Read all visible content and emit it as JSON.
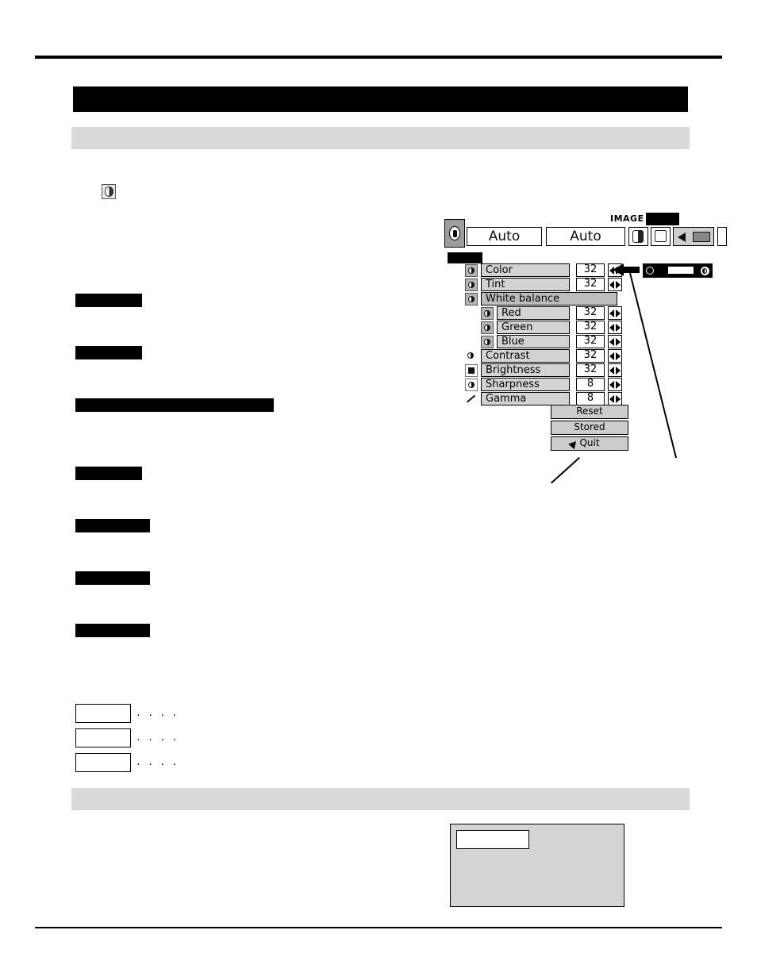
{
  "page": {
    "title_bar_redacted": true
  },
  "osd": {
    "image_label": "IMAGE",
    "auto_button_1": "Auto",
    "auto_button_2": "Auto",
    "menu_tag_char": "",
    "rows": [
      {
        "label": "Color",
        "value": "32",
        "icon": "color-icon",
        "indent": false,
        "highlight": false
      },
      {
        "label": "Tint",
        "value": "32",
        "icon": "tint-icon",
        "indent": false,
        "highlight": false
      },
      {
        "label": "White balance",
        "value": "",
        "icon": "white-balance-icon",
        "indent": false,
        "highlight": true
      },
      {
        "label": "Red",
        "value": "32",
        "icon": "red-icon",
        "indent": true,
        "highlight": false
      },
      {
        "label": "Green",
        "value": "32",
        "icon": "green-icon",
        "indent": true,
        "highlight": false
      },
      {
        "label": "Blue",
        "value": "32",
        "icon": "blue-icon",
        "indent": true,
        "highlight": false
      },
      {
        "label": "Contrast",
        "value": "32",
        "icon": "contrast-icon",
        "indent": false,
        "highlight": false
      },
      {
        "label": "Brightness",
        "value": "32",
        "icon": "brightness-icon",
        "indent": false,
        "highlight": false
      },
      {
        "label": "Sharpness",
        "value": "8",
        "icon": "sharpness-icon",
        "indent": false,
        "highlight": false
      },
      {
        "label": "Gamma",
        "value": "8",
        "icon": "gamma-icon",
        "indent": false,
        "highlight": false
      }
    ],
    "buttons": {
      "reset": "Reset",
      "stored": "Stored",
      "quit": "Quit"
    }
  },
  "dots": {
    "row1": "· · · ·",
    "row2": "· · · ·",
    "row3": "· · · ·"
  }
}
